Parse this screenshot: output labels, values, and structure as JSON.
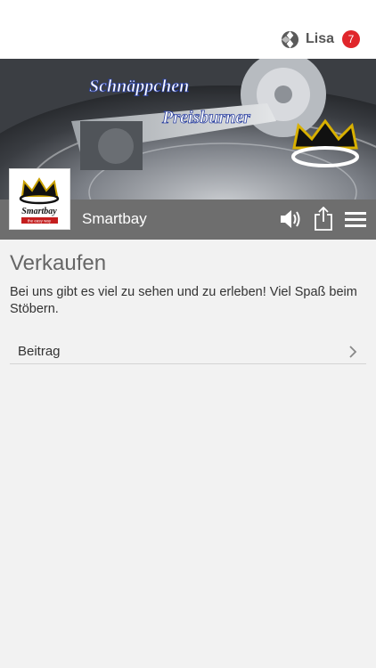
{
  "user": {
    "name": "Lisa",
    "notification_count": "7"
  },
  "banner": {
    "line1": "Schnäppchen",
    "line2": "Preisburner"
  },
  "app": {
    "name": "Smartbay",
    "logo_text": "Smartbay",
    "logo_tagline": "the easy way"
  },
  "page": {
    "title": "Verkaufen",
    "description": "Bei uns gibt es viel zu sehen und zu erleben! Viel Spaß beim Stöbern."
  },
  "list": {
    "items": [
      {
        "label": "Beitrag"
      }
    ]
  },
  "colors": {
    "badge": "#e0262b",
    "titlebar": "#6e6e6e",
    "background": "#f2f2f2"
  },
  "icons": [
    "user-logo-icon",
    "volume-icon",
    "share-icon",
    "menu-icon",
    "chevron-right-icon",
    "crown-icon"
  ]
}
